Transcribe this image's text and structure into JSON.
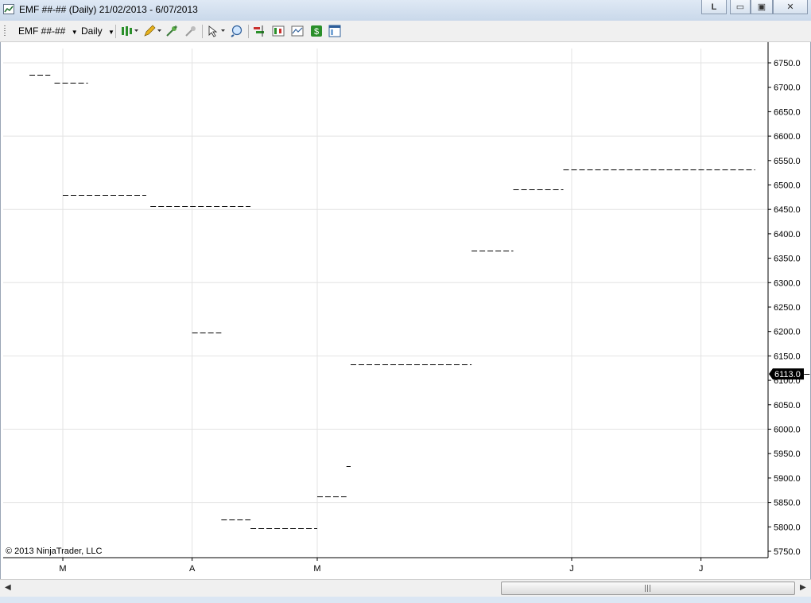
{
  "window": {
    "title": "EMF ##-## (Daily)  21/02/2013 - 6/07/2013",
    "buttons": {
      "link": "L",
      "minimize": "▭",
      "maximize": "▣",
      "close": "✕"
    }
  },
  "toolbar": {
    "instrument": "EMF ##-##",
    "interval": "Daily",
    "icons": [
      "bar-type-icon",
      "drawing-pencil-icon",
      "indicator-add-icon",
      "indicator-remove-icon",
      "cursor-select-icon",
      "zoom-icon",
      "strategy-icon",
      "bars-icon",
      "data-series-icon",
      "dollar-icon",
      "properties-icon"
    ]
  },
  "chart": {
    "copyright": "© 2013 NinjaTrader, LLC",
    "last_price_label": "6113.0",
    "price_marker_color": "#000000"
  },
  "chart_data": {
    "type": "line",
    "style": "dashed step segments",
    "ylim": [
      5740,
      6770
    ],
    "y_ticks": [
      "6750.0",
      "6700.0",
      "6650.0",
      "6600.0",
      "6550.0",
      "6500.0",
      "6450.0",
      "6400.0",
      "6350.0",
      "6300.0",
      "6250.0",
      "6200.0",
      "6150.0",
      "6100.0",
      "6050.0",
      "6000.0",
      "5950.0",
      "5900.0",
      "5850.0",
      "5800.0",
      "5750.0"
    ],
    "x_ticks": [
      "M",
      "A",
      "M",
      "J",
      "J"
    ],
    "grid": true,
    "series": [
      {
        "segments": [
          {
            "start": "2013-02-21",
            "end": "2013-02-26",
            "value": 6726
          },
          {
            "start": "2013-02-27",
            "end": "2013-03-07",
            "value": 6710
          },
          {
            "start": "2013-03-01",
            "end": "2013-03-21",
            "value": 6480
          },
          {
            "start": "2013-03-22",
            "end": "2013-04-15",
            "value": 6457
          },
          {
            "start": "2013-04-01",
            "end": "2013-04-08",
            "value": 6198
          },
          {
            "start": "2013-04-08",
            "end": "2013-04-15",
            "value": 5815
          },
          {
            "start": "2013-04-15",
            "end": "2013-05-01",
            "value": 5797
          },
          {
            "start": "2013-05-01",
            "end": "2013-05-08",
            "value": 5862
          },
          {
            "start": "2013-05-08",
            "end": "2013-05-09",
            "value": 5925
          },
          {
            "start": "2013-05-09",
            "end": "2013-06-07",
            "value": 6132
          },
          {
            "start": "2013-06-07",
            "end": "2013-06-17",
            "value": 6366
          },
          {
            "start": "2013-06-17",
            "end": "2013-06-29",
            "value": 6491
          },
          {
            "start": "2013-06-29",
            "end": "2013-08-14",
            "value": 6532
          },
          {
            "start": "2013-08-20",
            "end": "2013-09-02",
            "value": 6113
          }
        ]
      }
    ]
  }
}
